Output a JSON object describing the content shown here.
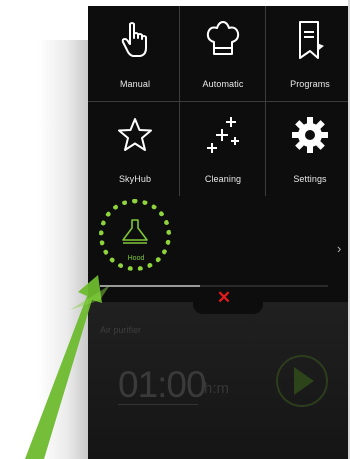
{
  "tiles": [
    {
      "label": "Manual",
      "icon": "hand-pointer-icon"
    },
    {
      "label": "Automatic",
      "icon": "chef-hat-icon"
    },
    {
      "label": "Programs",
      "icon": "recipe-book-icon"
    },
    {
      "label": "SkyHub",
      "icon": "star-icon"
    },
    {
      "label": "Cleaning",
      "icon": "sparkles-icon"
    },
    {
      "label": "Settings",
      "icon": "gear-icon"
    }
  ],
  "hood": {
    "label": "Hood",
    "icon": "hood-icon",
    "highlight_color": "#8ed43a"
  },
  "close_symbol": "✕",
  "lower": {
    "title": "Air purifier",
    "timer": "01:00",
    "unit": "h:m"
  },
  "colors": {
    "background": "#0d0d0d",
    "accent": "#8ed43a",
    "close": "#e01b1b",
    "arrow": "#6dbb2f"
  }
}
